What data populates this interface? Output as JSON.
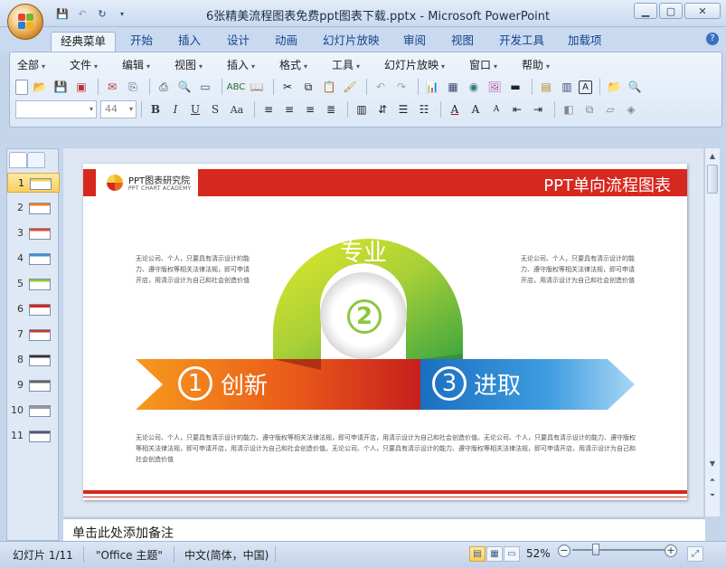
{
  "window": {
    "title": "6张精美流程图表免费ppt图表下载.pptx - Microsoft PowerPoint"
  },
  "ribbon_tabs": [
    "经典菜单",
    "开始",
    "插入",
    "设计",
    "动画",
    "幻灯片放映",
    "审阅",
    "视图",
    "开发工具",
    "加载项"
  ],
  "classic_menu": [
    "全部",
    "文件",
    "编辑",
    "视图",
    "插入",
    "格式",
    "工具",
    "幻灯片放映",
    "窗口",
    "帮助"
  ],
  "font_size_value": "44",
  "slide_thumbnails": [
    "1",
    "2",
    "3",
    "4",
    "5",
    "6",
    "7",
    "8",
    "9",
    "10",
    "11"
  ],
  "slide": {
    "logo_text": "PPT图表研究院",
    "logo_subtext": "PPT CHART ACADEMY",
    "title": "PPT单向流程图表",
    "left_text": "无论公司、个人，只要具有清示设计的能力、遵守版权等相关法律法规，即可申请开店，用清示设计为自己和社会创造价值",
    "right_text": "无论公司、个人，只要具有清示设计的能力、遵守版权等相关法律法规，即可申请开店，用清示设计为自己和社会创造价值",
    "bottom_text": "无论公司、个人，只要具有清示设计的能力、遵守版权等相关法律法规，即可申请开店，用清示设计为自己和社会创造价值。无论公司、个人，只要具有清示设计的能力、遵守版权等相关法律法规，即可申请开店，用清示设计为自己和社会创造价值。无论公司、个人，只要具有清示设计的能力、遵守版权等相关法律法规，即可申请开店，用清示设计为自己和社会创造价值",
    "steps": [
      {
        "num": "1",
        "label": "创新"
      },
      {
        "num": "2",
        "label": "专业"
      },
      {
        "num": "3",
        "label": "进取"
      }
    ]
  },
  "notes_placeholder": "单击此处添加备注",
  "status": {
    "slide_info": "幻灯片 1/11",
    "theme": "\"Office 主题\"",
    "language": "中文(简体，中国)",
    "zoom": "52%"
  },
  "colors": {
    "accent_red": "#d6281f",
    "step1_orange": "#f07f1b",
    "step2_green": "#8cc63f",
    "step3_blue": "#3a8fd6"
  }
}
